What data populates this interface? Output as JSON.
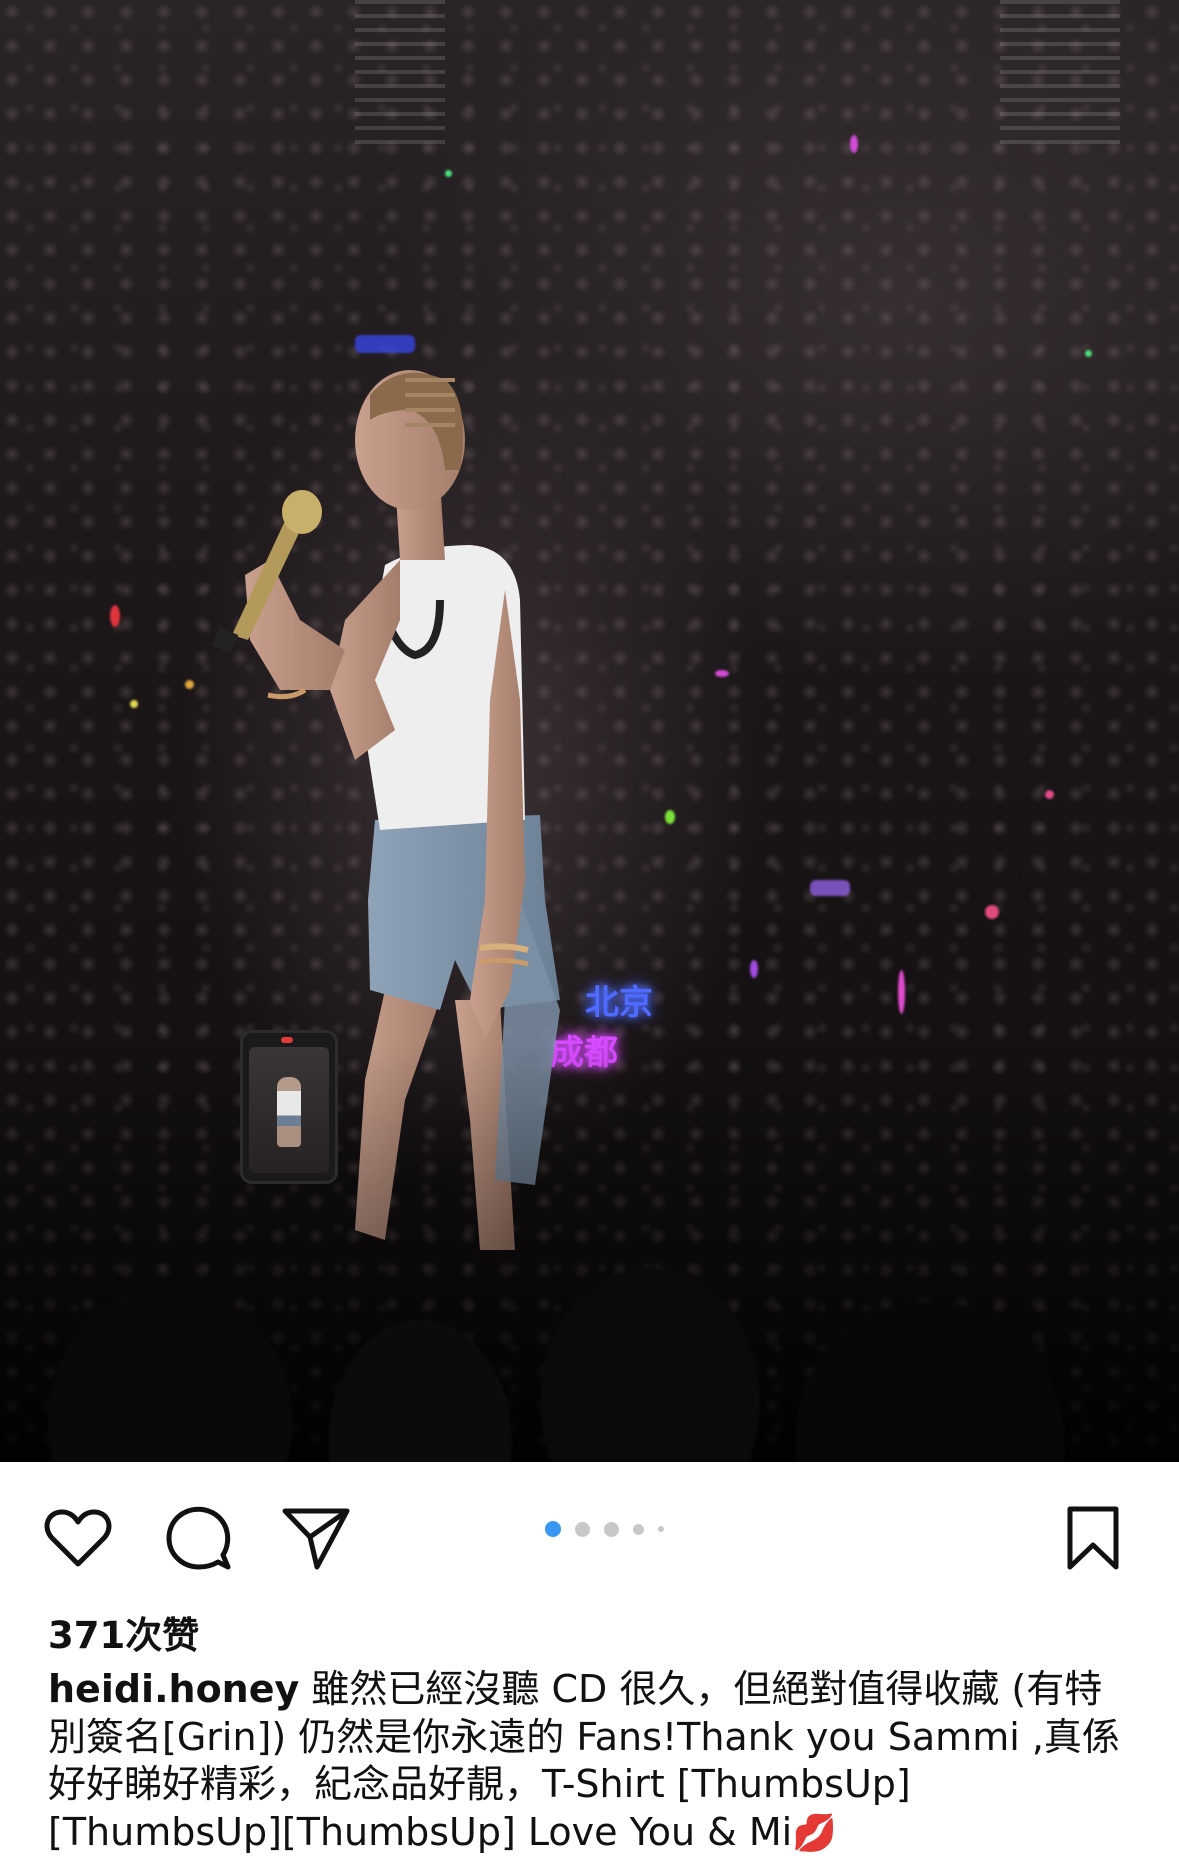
{
  "post": {
    "photo_alt": "Singer performing on stage with microphone",
    "carousel": {
      "total": 5,
      "active": 1
    }
  },
  "actions": {
    "like_icon": "heart-outline-icon",
    "comment_icon": "speech-bubble-icon",
    "share_icon": "paper-plane-icon",
    "save_icon": "bookmark-outline-icon"
  },
  "likes_text": "371次赞",
  "caption": {
    "username": "heidi.honey",
    "text": " 雖然已經沒聽 CD 很久，但絕對值得收藏 (有特別簽名[Grin]) 仍然是你永遠的 Fans!Thank you Sammi ,真係好好睇好精彩，紀念品好靚，T-Shirt [ThumbsUp][ThumbsUp][ThumbsUp] Love You & Mi",
    "emoji": "💋"
  },
  "photo_signs": {
    "sign1": "北京",
    "sign2": "成都"
  },
  "colors": {
    "background": "#ffffff",
    "text": "#111111",
    "dot_active": "#3897f0",
    "dot_inactive": "#c8c8c8"
  }
}
